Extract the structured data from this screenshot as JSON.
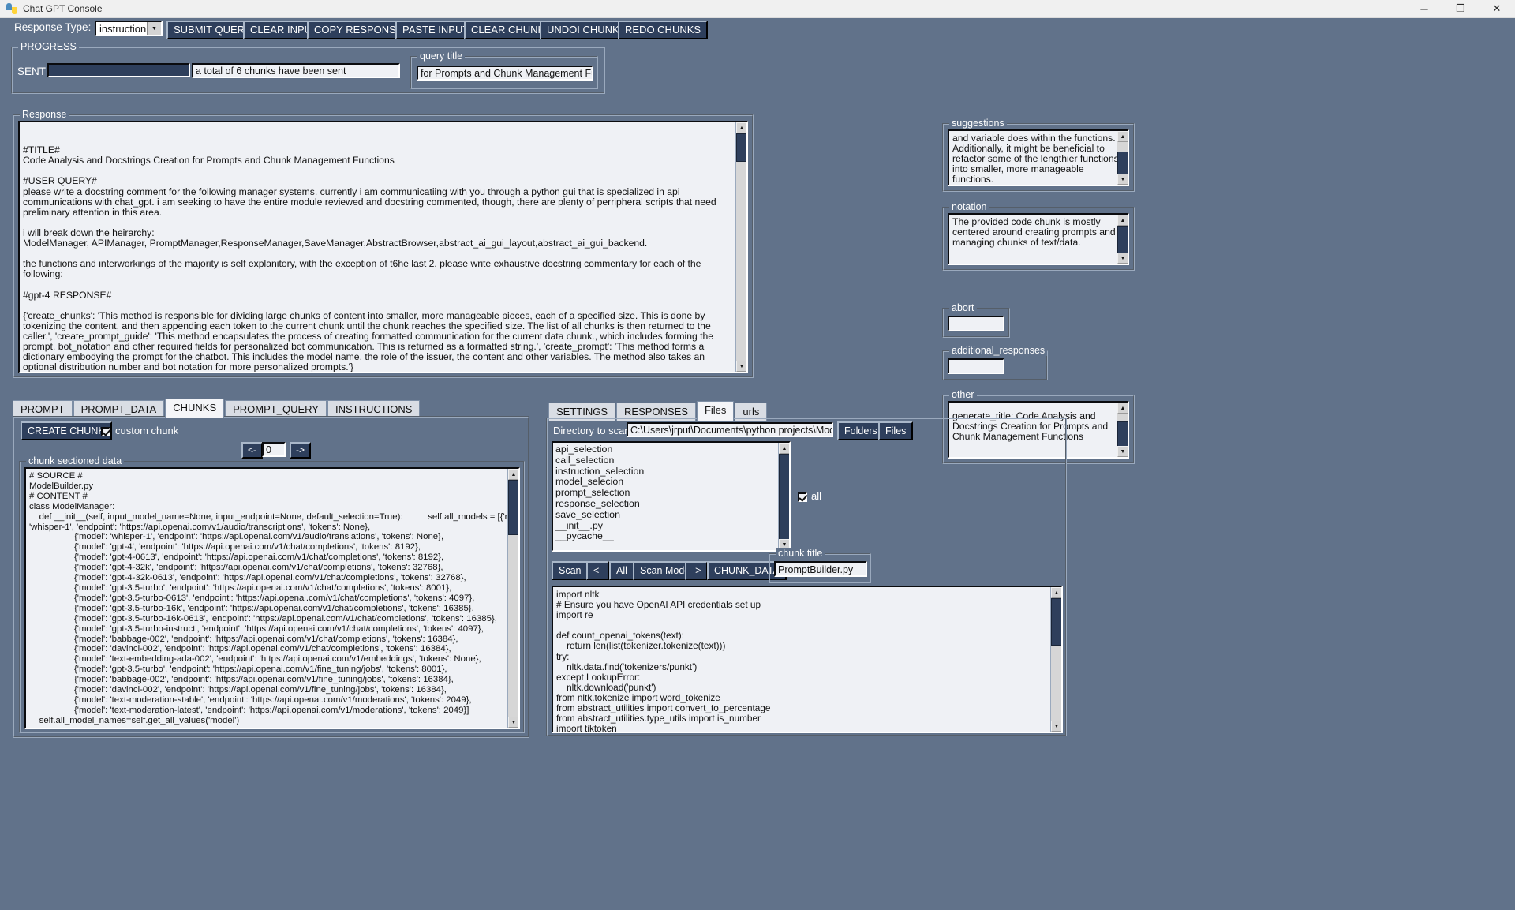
{
  "window": {
    "title": "Chat GPT Console",
    "icon": "python-logo-icon",
    "minimize": "─",
    "maximize": "❐",
    "close": "✕"
  },
  "toolbar": {
    "response_type_label": "Response Type:",
    "response_type_value": "instruction",
    "buttons": [
      "SUBMIT QUERY",
      "CLEAR INPUT",
      "COPY RESPONSE",
      "PASTE INPUT",
      "CLEAR CHUNKS",
      "UNDOI CHUNKS",
      "REDO CHUNKS"
    ]
  },
  "progress": {
    "title": "PROGRESS",
    "sent_label": "SENT",
    "sent_status": "a total of 6 chunks have been sent",
    "query_title_label": "query title",
    "query_title_value": "for Prompts and Chunk Management Functions"
  },
  "response": {
    "title": "Response",
    "text": "\n\n#TITLE#\nCode Analysis and Docstrings Creation for Prompts and Chunk Management Functions\n\n#USER QUERY#\nplease write a docstring comment for the following manager systems. currently i am communicatiing with you through a python gui that is specialized in api communications with chat_gpt. i am seeking to have the entire module reviewed and docstring commented, though, there are plenty of perripheral scripts that need preliminary attention in this area.\n\ni will break down the heirarchy:\nModelManager, APIManager, PromptManager,ResponseManager,SaveManager,AbstractBrowser,abstract_ai_gui_layout,abstract_ai_gui_backend.\n\nthe functions and interworkings of the majority is self explanitory, with the exception of t6he last 2. please write exhaustive docstring commentary for each of the following:\n\n#gpt-4 RESPONSE#\n\n{'create_chunks': 'This method is responsible for dividing large chunks of content into smaller, more manageable pieces, each of a specified size. This is done by tokenizing the content, and then appending each token to the current chunk until the chunk reaches the specified size. The list of all chunks is then returned to the caller.', 'create_prompt_guide': 'This method encapsulates the process of creating formatted communication for the current data chunk., which includes forming the prompt, bot_notation and other required fields for personalized bot communication. This is returned as a formatted string.', 'create_prompt': 'This method forms a dictionary embodying the prompt for the chatbot. This includes the model name, the role of the issuer, the content and other variables. The method also takes an optional distribution number and bot notation for more personalized prompts.'}"
  },
  "suggestions": {
    "title": "suggestions",
    "text": "and variable does within the functions. Additionally, it might be beneficial to refactor some of the lengthier functions into smaller, more manageable functions."
  },
  "notation": {
    "title": "notation",
    "text": "The provided code chunk is mostly centered around creating prompts and managing chunks of text/data."
  },
  "abort": {
    "title": "abort",
    "value": ""
  },
  "additional_responses": {
    "title": "additional_responses",
    "value": ""
  },
  "other": {
    "title": "other",
    "text": "generate_title: Code Analysis and Docstrings Creation for Prompts and Chunk Management Functions"
  },
  "left_panel": {
    "tabs": [
      {
        "label": "PROMPT",
        "selected": false
      },
      {
        "label": "PROMPT_DATA",
        "selected": false
      },
      {
        "label": "CHUNKS",
        "selected": true
      },
      {
        "label": "PROMPT_QUERY",
        "selected": false
      },
      {
        "label": "INSTRUCTIONS",
        "selected": false
      }
    ],
    "create_chunk_button": "CREATE CHUNK",
    "custom_chunk_label": "custom chunk",
    "custom_chunk_checked": true,
    "nav_prev": "<-",
    "nav_index": "0",
    "nav_next": "->",
    "chunk_group_title": "chunk sectioned data",
    "chunk_text": "# SOURCE #\nModelBuilder.py\n# CONTENT #\nclass ModelManager:\n    def __init__(self, input_model_name=None, input_endpoint=None, default_selection=True):          self.all_models = [{'model':\n'whisper-1', 'endpoint': 'https://api.openai.com/v1/audio/transcriptions', 'tokens': None},\n                  {'model': 'whisper-1', 'endpoint': 'https://api.openai.com/v1/audio/translations', 'tokens': None},\n                  {'model': 'gpt-4', 'endpoint': 'https://api.openai.com/v1/chat/completions', 'tokens': 8192},\n                  {'model': 'gpt-4-0613', 'endpoint': 'https://api.openai.com/v1/chat/completions', 'tokens': 8192},\n                  {'model': 'gpt-4-32k', 'endpoint': 'https://api.openai.com/v1/chat/completions', 'tokens': 32768},\n                  {'model': 'gpt-4-32k-0613', 'endpoint': 'https://api.openai.com/v1/chat/completions', 'tokens': 32768},\n                  {'model': 'gpt-3.5-turbo', 'endpoint': 'https://api.openai.com/v1/chat/completions', 'tokens': 8001},\n                  {'model': 'gpt-3.5-turbo-0613', 'endpoint': 'https://api.openai.com/v1/chat/completions', 'tokens': 4097},\n                  {'model': 'gpt-3.5-turbo-16k', 'endpoint': 'https://api.openai.com/v1/chat/completions', 'tokens': 16385},\n                  {'model': 'gpt-3.5-turbo-16k-0613', 'endpoint': 'https://api.openai.com/v1/chat/completions', 'tokens': 16385},\n                  {'model': 'gpt-3.5-turbo-instruct', 'endpoint': 'https://api.openai.com/v1/chat/completions', 'tokens': 4097},\n                  {'model': 'babbage-002', 'endpoint': 'https://api.openai.com/v1/chat/completions', 'tokens': 16384},\n                  {'model': 'davinci-002', 'endpoint': 'https://api.openai.com/v1/chat/completions', 'tokens': 16384},\n                  {'model': 'text-embedding-ada-002', 'endpoint': 'https://api.openai.com/v1/embeddings', 'tokens': None},\n                  {'model': 'gpt-3.5-turbo', 'endpoint': 'https://api.openai.com/v1/fine_tuning/jobs', 'tokens': 8001},\n                  {'model': 'babbage-002', 'endpoint': 'https://api.openai.com/v1/fine_tuning/jobs', 'tokens': 16384},\n                  {'model': 'davinci-002', 'endpoint': 'https://api.openai.com/v1/fine_tuning/jobs', 'tokens': 16384},\n                  {'model': 'text-moderation-stable', 'endpoint': 'https://api.openai.com/v1/moderations', 'tokens': 2049},\n                  {'model': 'text-moderation-latest', 'endpoint': 'https://api.openai.com/v1/moderations', 'tokens': 2049}]\n    self.all_model_names=self.get_all_values('model')"
  },
  "right_panel": {
    "tabs": [
      {
        "label": "SETTINGS",
        "selected": false
      },
      {
        "label": "RESPONSES",
        "selected": false
      },
      {
        "label": "Files",
        "selected": true
      },
      {
        "label": "urls",
        "selected": false
      }
    ],
    "directory_label": "Directory to scan:",
    "directory_value": "C:\\Users\\jrput\\Documents\\python projects\\Modules\\tes",
    "folders_button": "Folders",
    "files_button": "Files",
    "file_list": [
      "api_selection",
      "call_selection",
      "instruction_selection",
      "model_selecion",
      "prompt_selection",
      "response_selection",
      "save_selection",
      "__init__.py",
      "__pycache__"
    ],
    "all_label": "all",
    "all_checked": true,
    "scan_button": "Scan",
    "prev_button": "<-",
    "all_button": "All",
    "scan_mode_button": "Scan Mode",
    "next_button": "->",
    "chunk_data_button": "CHUNK_DATA",
    "chunk_title_label": "chunk title",
    "chunk_title_value": "PromptBuilder.py",
    "preview_text": "import nltk\n# Ensure you have OpenAI API credentials set up\nimport re\n\ndef count_openai_tokens(text):\n    return len(list(tokenizer.tokenize(text)))\ntry:\n    nltk.data.find('tokenizers/punkt')\nexcept LookupError:\n    nltk.download('punkt')\nfrom nltk.tokenize import word_tokenize\nfrom abstract_utilities import convert_to_percentage\nfrom abstract_utilities.type_utils import is_number\nimport tiktoken"
  },
  "colors": {
    "background": "#61728a",
    "button": "#2e3f5c",
    "field": "#eff1f5",
    "titlebar": "#f0f0f0"
  }
}
